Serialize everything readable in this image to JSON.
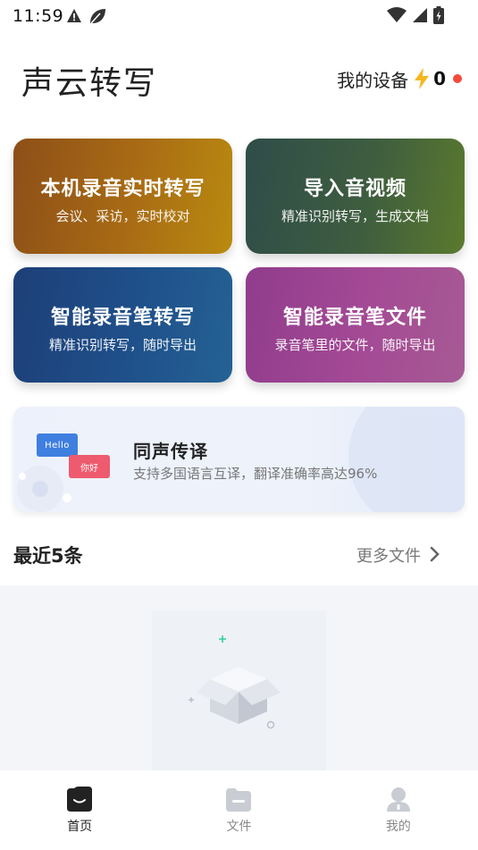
{
  "status_bar": {
    "time": "11:59"
  },
  "header": {
    "title": "声云转写",
    "device_label": "我的设备",
    "device_count": "0",
    "accent_dot_color": "#f24b3c"
  },
  "cards": [
    {
      "title": "本机录音实时转写",
      "subtitle": "会议、采访，实时校对"
    },
    {
      "title": "导入音视频",
      "subtitle": "精准识别转写，生成文档"
    },
    {
      "title": "智能录音笔转写",
      "subtitle": "精准识别转写，随时导出"
    },
    {
      "title": "智能录音笔文件",
      "subtitle": "录音笔里的文件，随时导出"
    }
  ],
  "banner": {
    "title": "同声传译",
    "subtitle": "支持多国语言互译，翻译准确率高达96%",
    "bubble_en": "Hello",
    "bubble_zh": "你好"
  },
  "recent": {
    "title": "最近5条",
    "more_label": "更多文件"
  },
  "bottom_nav": {
    "items": [
      {
        "label": "首页",
        "icon": "home-icon",
        "active": true
      },
      {
        "label": "文件",
        "icon": "folder-icon",
        "active": false
      },
      {
        "label": "我的",
        "icon": "profile-icon",
        "active": false
      }
    ]
  }
}
